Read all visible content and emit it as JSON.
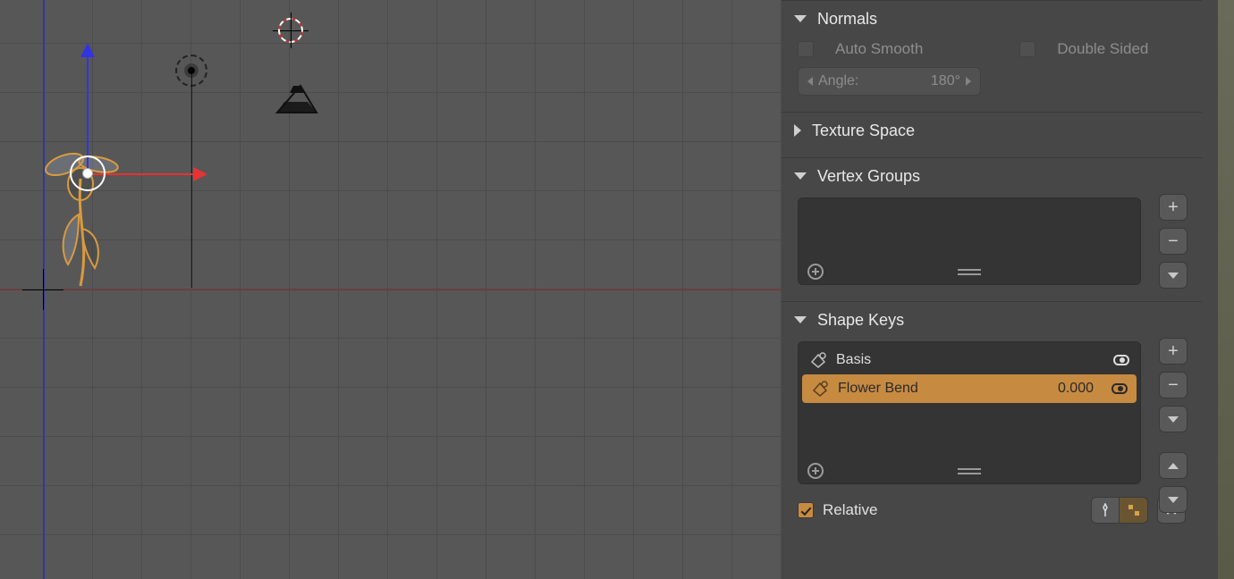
{
  "normals": {
    "title": "Normals",
    "auto_smooth_label": "Auto Smooth",
    "double_sided_label": "Double Sided",
    "angle_label": "Angle:",
    "angle_value": "180°"
  },
  "texture_space": {
    "title": "Texture Space"
  },
  "vertex_groups": {
    "title": "Vertex Groups"
  },
  "shape_keys": {
    "title": "Shape Keys",
    "items": [
      {
        "name": "Basis",
        "value": "",
        "active": false
      },
      {
        "name": "Flower Bend",
        "value": "0.000",
        "active": true
      }
    ],
    "relative_label": "Relative"
  }
}
